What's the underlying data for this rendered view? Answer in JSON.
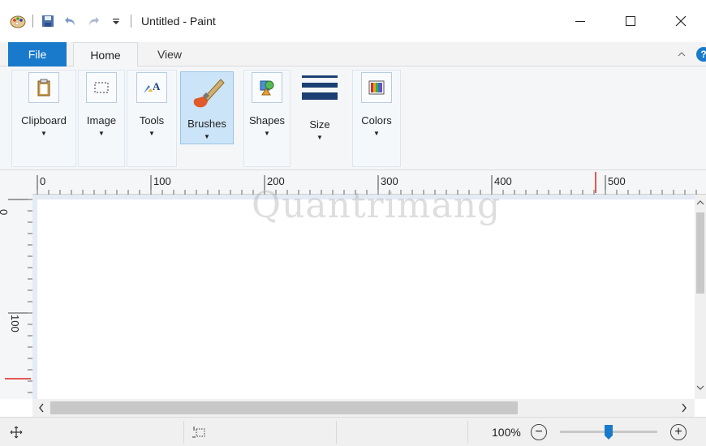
{
  "window": {
    "title": "Untitled - Paint",
    "minimize_symbol": "—",
    "maximize_symbol": "☐",
    "close_symbol": "✕"
  },
  "qat": {
    "icons": [
      "paint-app-icon",
      "save-icon",
      "undo-icon",
      "redo-icon",
      "customize-qat-icon"
    ]
  },
  "tabs": {
    "file": "File",
    "home": "Home",
    "view": "View",
    "collapse_symbol": "^",
    "help_symbol": "?"
  },
  "ribbon": {
    "groups": [
      {
        "label": "Clipboard",
        "icon": "clipboard-icon"
      },
      {
        "label": "Image",
        "icon": "select-icon"
      },
      {
        "label": "Tools",
        "icon": "tools-icon"
      },
      {
        "label": "Brushes",
        "icon": "brush-icon"
      },
      {
        "label": "Shapes",
        "icon": "shapes-icon"
      },
      {
        "label": "Size",
        "icon": "size-icon"
      },
      {
        "label": "Colors",
        "icon": "colors-icon"
      }
    ],
    "dropdown_symbol": "▼",
    "selected": "Brushes"
  },
  "ruler": {
    "horizontal": [
      "0",
      "100",
      "200",
      "300",
      "400",
      "500"
    ],
    "vertical": [
      "0",
      "100"
    ]
  },
  "watermark": "Quantrimang",
  "scroll": {
    "left_arrow": "<",
    "right_arrow": ">",
    "up_arrow": "^",
    "down_arrow": "v"
  },
  "status": {
    "zoom": "100%",
    "zoom_level_fraction": 0.5,
    "zoom_out_symbol": "−",
    "zoom_in_symbol": "+"
  },
  "colors": {
    "accent": "#1979ca",
    "ruler_marker": "#e02020",
    "selected_bg": "#cce4f7"
  }
}
